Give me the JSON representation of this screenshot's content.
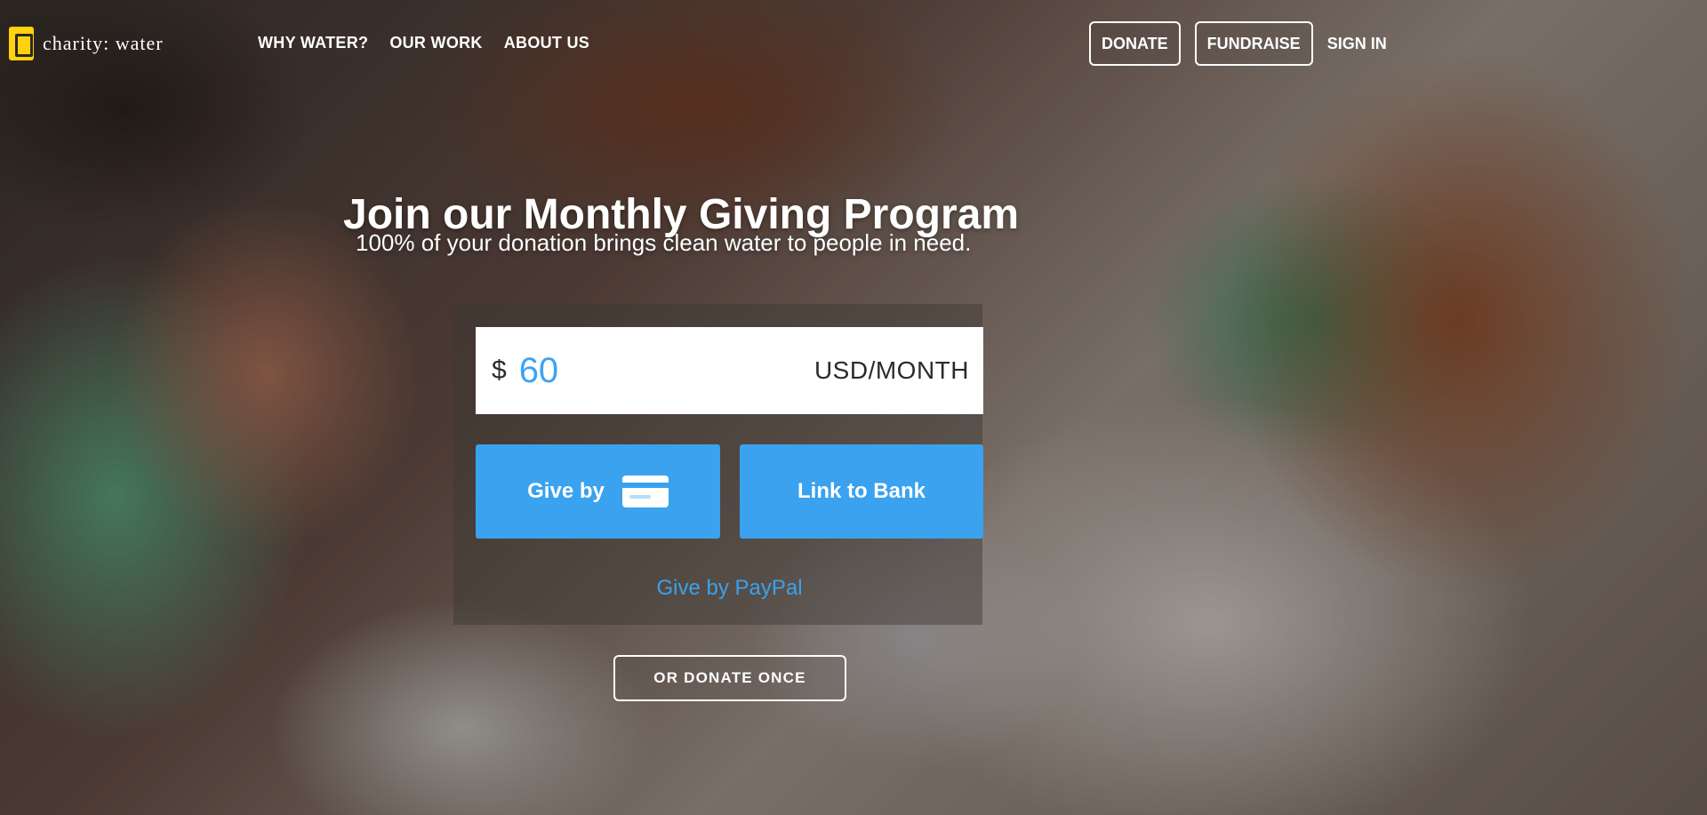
{
  "brand": {
    "name": "charity: water",
    "logo_icon": "jerrycan-icon",
    "logo_color": "#ffd10f"
  },
  "nav": {
    "links": [
      "WHY WATER?",
      "OUR WORK",
      "ABOUT US"
    ],
    "donate_label": "DONATE",
    "fundraise_label": "FUNDRAISE",
    "signin_label": "SIGN IN"
  },
  "hero": {
    "title": "Join our Monthly Giving Program",
    "subtitle": "100% of your donation brings clean water to people in need."
  },
  "form": {
    "currency_symbol": "$",
    "amount_value": "60",
    "amount_unit": "USD/MONTH",
    "give_card_label": "Give by",
    "card_icon": "credit-card-icon",
    "link_bank_label": "Link to Bank",
    "paypal_label": "Give by PayPal",
    "donate_once_label": "OR DONATE ONCE"
  },
  "colors": {
    "accent": "#3aa2ee",
    "amount_text": "#3da3f4"
  }
}
